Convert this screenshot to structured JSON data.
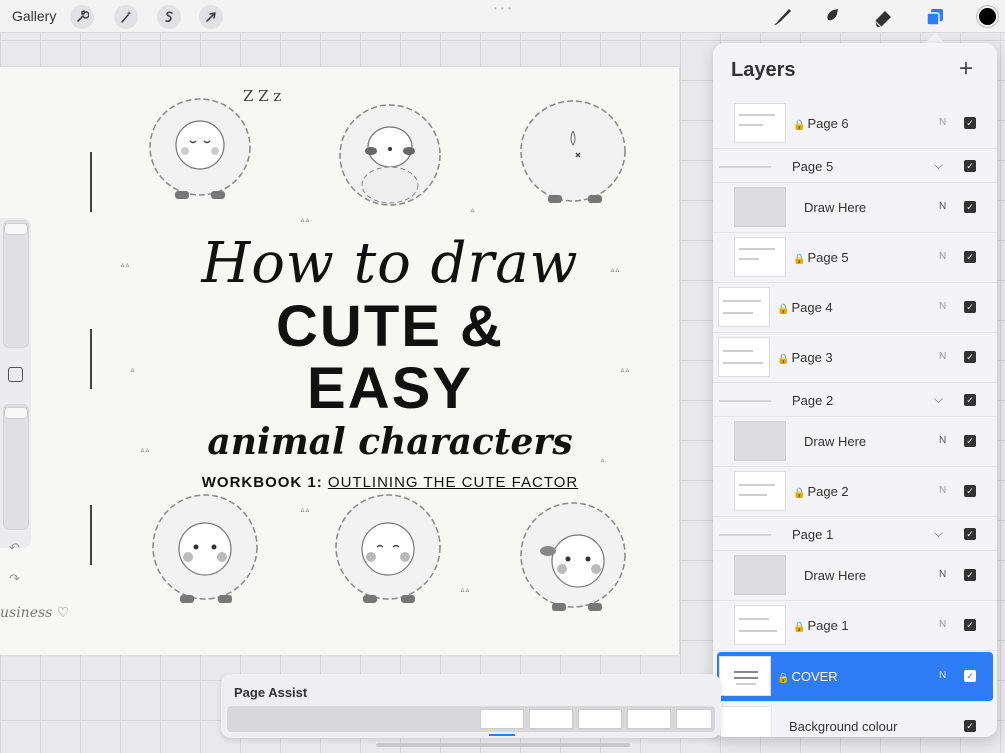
{
  "topbar": {
    "gallery_label": "Gallery",
    "tools_left": [
      "wrench-icon",
      "magic-wand-icon",
      "selection-icon",
      "transform-arrow-icon"
    ],
    "tools_right": [
      "brush-icon",
      "smudge-icon",
      "eraser-icon",
      "layers-icon"
    ],
    "current_color": "#000000"
  },
  "canvas": {
    "title_line1": "How to draw",
    "title_line2": "CUTE & EASY",
    "title_line3": "animal characters",
    "workbook_label": "WORKBOOK 1:",
    "workbook_subtitle": "OUTLINING THE CUTE FACTOR",
    "zzz": "Z Z z",
    "signature": "usiness ♡"
  },
  "layers": {
    "title": "Layers",
    "add_label": "+",
    "rows": [
      {
        "name": "Page 6",
        "type": "layer",
        "locked": true,
        "blend": "N",
        "visible": true
      },
      {
        "name": "Page 5",
        "type": "group",
        "expanded": true,
        "visible": true
      },
      {
        "name": "Draw Here",
        "type": "layer",
        "locked": false,
        "blend": "N",
        "visible": true
      },
      {
        "name": "Page 5",
        "type": "layer",
        "locked": true,
        "blend": "N",
        "visible": true
      },
      {
        "name": "Page 4",
        "type": "layer",
        "locked": true,
        "blend": "N",
        "visible": true
      },
      {
        "name": "Page 3",
        "type": "layer",
        "locked": true,
        "blend": "N",
        "visible": true
      },
      {
        "name": "Page 2",
        "type": "group",
        "expanded": true,
        "visible": true
      },
      {
        "name": "Draw Here",
        "type": "layer",
        "locked": false,
        "blend": "N",
        "visible": true
      },
      {
        "name": "Page 2",
        "type": "layer",
        "locked": true,
        "blend": "N",
        "visible": true
      },
      {
        "name": "Page 1",
        "type": "group",
        "expanded": true,
        "visible": true
      },
      {
        "name": "Draw Here",
        "type": "layer",
        "locked": false,
        "blend": "N",
        "visible": true
      },
      {
        "name": "Page 1",
        "type": "layer",
        "locked": true,
        "blend": "N",
        "visible": true
      },
      {
        "name": "COVER",
        "type": "layer",
        "locked": true,
        "blend": "N",
        "visible": true,
        "selected": true
      },
      {
        "name": "Background colour",
        "type": "background",
        "visible": true
      }
    ]
  },
  "page_assist": {
    "title": "Page Assist"
  },
  "colors": {
    "accent": "#2e7cf6",
    "panel": "#f4f4f6"
  }
}
